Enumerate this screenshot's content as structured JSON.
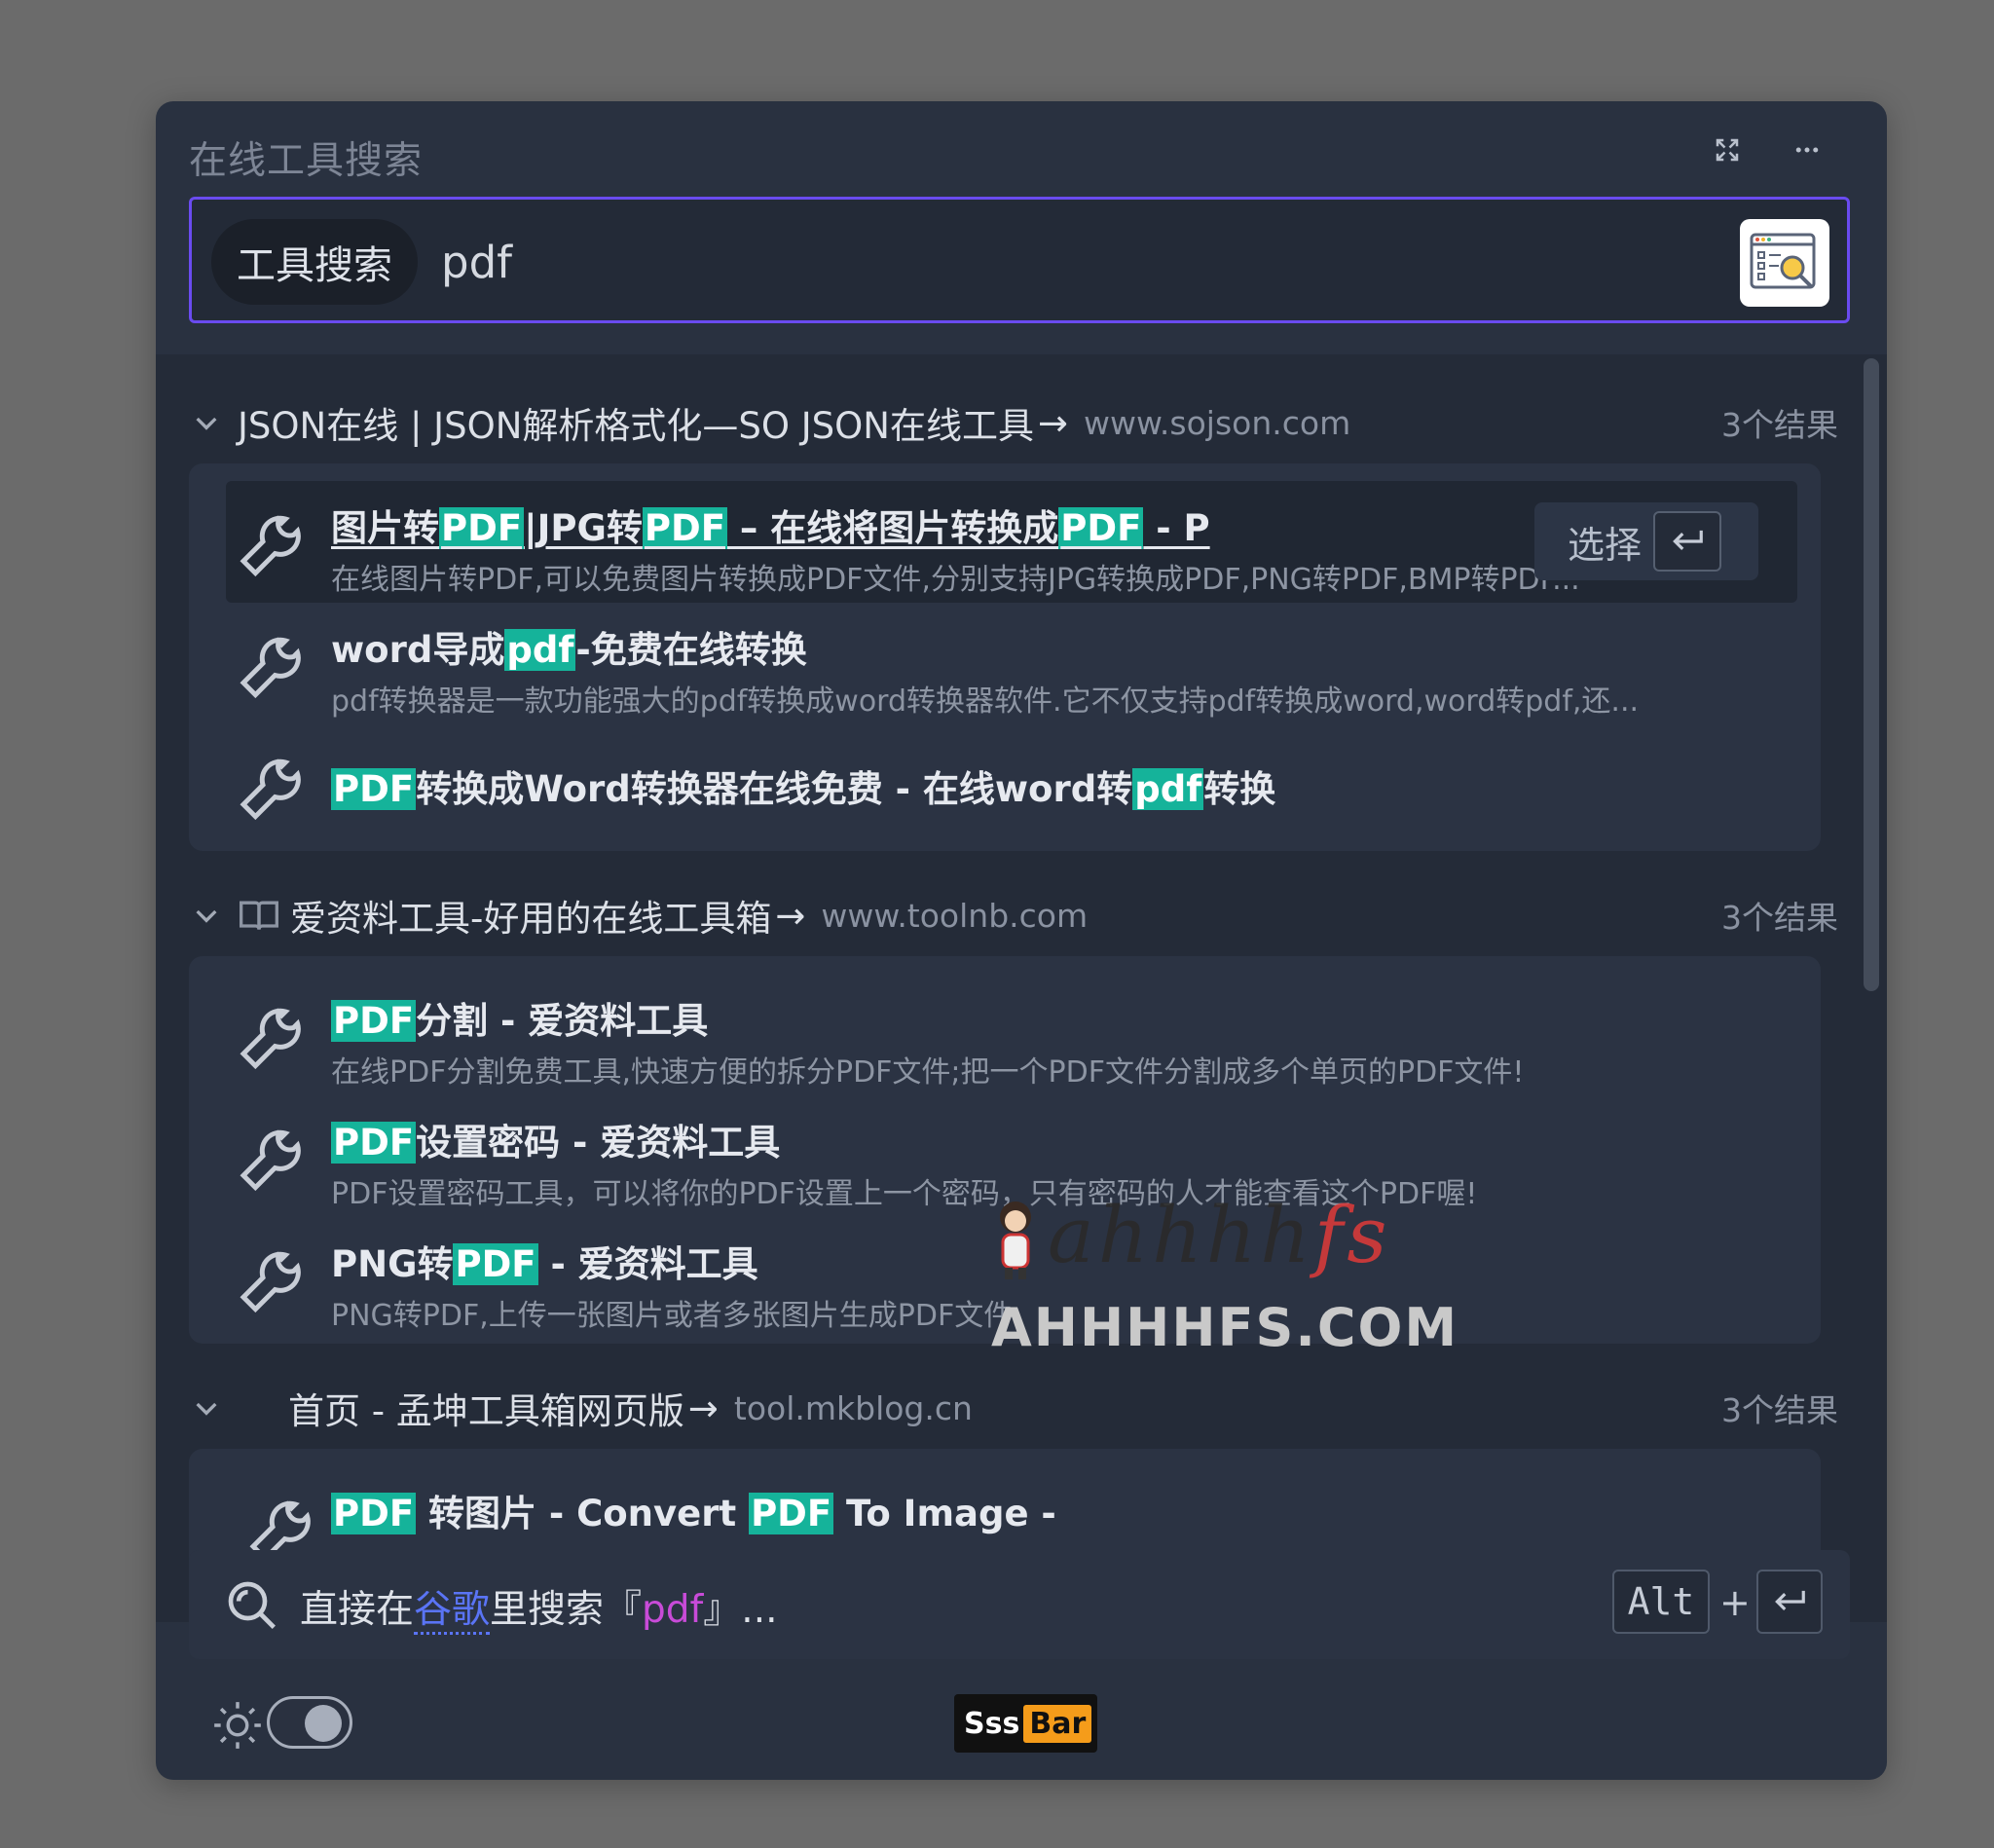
{
  "window": {
    "title": "在线工具搜索"
  },
  "search": {
    "chip_label": "工具搜索",
    "query": "pdf"
  },
  "groups": [
    {
      "title": "JSON在线 | JSON解析格式化—SO JSON在线工具",
      "site": "www.sojson.com",
      "count": "3个结果",
      "items": [
        {
          "title_parts": [
            "图片转",
            "PDF",
            "|JPG转",
            "PDF",
            " – 在线将图片转换成",
            "PDF",
            " - P"
          ],
          "desc": "在线图片转PDF,可以免费图片转换成PDF文件,分别支持JPG转换成PDF,PNG转PDF,BMP转PDF..."
        },
        {
          "title_parts": [
            "word导成",
            "pdf",
            "-免费在线转换"
          ],
          "desc": "pdf转换器是一款功能强大的pdf转换成word转换器软件.它不仅支持pdf转换成word,word转pdf,还..."
        },
        {
          "title_parts": [
            "",
            "PDF",
            "转换成Word转换器在线免费 - 在线word转",
            "pdf",
            "转换"
          ],
          "desc": ""
        }
      ]
    },
    {
      "title": "爱资料工具-好用的在线工具箱",
      "site": "www.toolnb.com",
      "count": "3个结果",
      "items": [
        {
          "title_parts": [
            "",
            "PDF",
            "分割 - 爱资料工具"
          ],
          "desc": "在线PDF分割免费工具,快速方便的拆分PDF文件;把一个PDF文件分割成多个单页的PDF文件!"
        },
        {
          "title_parts": [
            "",
            "PDF",
            "设置密码 - 爱资料工具"
          ],
          "desc": "PDF设置密码工具，可以将你的PDF设置上一个密码，只有密码的人才能查看这个PDF喔!"
        },
        {
          "title_parts": [
            "PNG转",
            "PDF",
            " - 爱资料工具"
          ],
          "desc": "PNG转PDF,上传一张图片或者多张图片生成PDF文件."
        }
      ]
    },
    {
      "title": "首页 - 孟坤工具箱网页版",
      "site": "tool.mkblog.cn",
      "count": "3个结果",
      "items": [
        {
          "title_parts": [
            "",
            "PDF",
            " 转图片 - Convert ",
            "PDF",
            " To Image -"
          ],
          "desc": ""
        }
      ]
    }
  ],
  "select_button": {
    "label": "选择"
  },
  "footer": {
    "prefix": "直接在",
    "engine": "谷歌",
    "middle": "里搜索『",
    "query": "pdf",
    "suffix": "』...",
    "alt_key": "Alt",
    "plus": "+"
  },
  "brand": {
    "part1": "Sss",
    "part2": "Bar"
  },
  "watermark": {
    "top_a": "ahhhh",
    "top_b": "fs",
    "bottom": "AHHHHFS.COM"
  },
  "colors": {
    "accent": "#6a4bf0",
    "highlight": "#15b39a",
    "engine": "#5a74f5",
    "query": "#c84bd8",
    "brand_bar": "#f59c1a"
  }
}
